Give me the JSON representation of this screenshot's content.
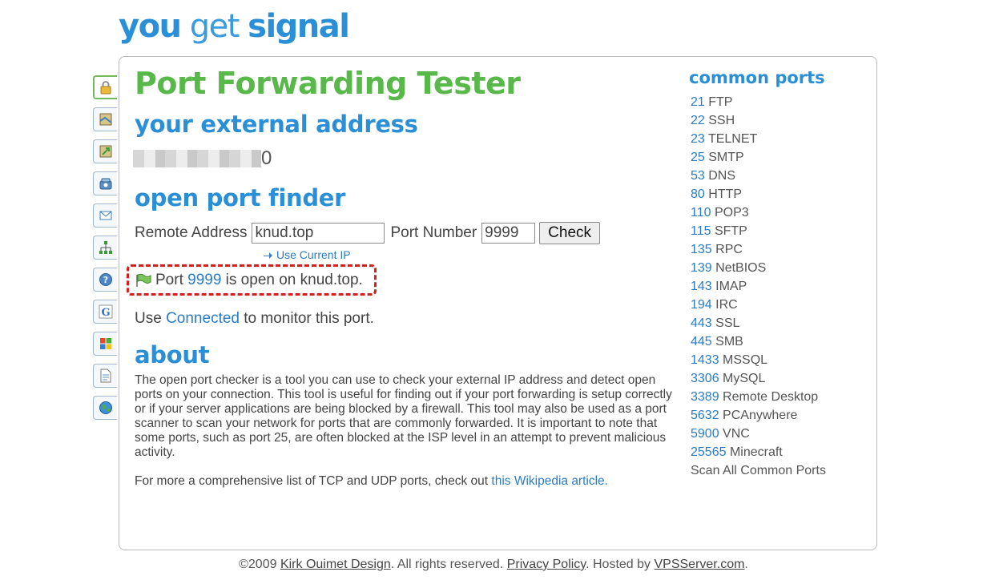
{
  "logo": {
    "part1": "you",
    "part2": "get",
    "part3": "signal"
  },
  "side_tabs": [
    "lock-icon",
    "map-icon",
    "map-arrow-icon",
    "phone-icon",
    "mail-icon",
    "network-icon",
    "help-icon",
    "google-icon",
    "windows-icon",
    "document-icon",
    "globe-icon"
  ],
  "main": {
    "title": "Port Forwarding Tester",
    "external_heading": "your external address",
    "external_ip_visible": "0",
    "finder_heading": "open port finder",
    "remote_address_label": "Remote Address",
    "remote_address_value": "knud.top",
    "port_number_label": "Port Number",
    "port_value": "9999",
    "check_label": "Check",
    "use_current_ip": "Use Current IP",
    "result": {
      "prefix": "Port ",
      "port": "9999",
      "suffix": " is open on knud.top."
    },
    "monitor": {
      "prefix": "Use ",
      "link": "Connected",
      "suffix": " to monitor this port."
    },
    "about_heading": "about",
    "about_text": "The open port checker is a tool you can use to check your external IP address and detect open ports on your connection. This tool is useful for finding out if your port forwarding is setup correctly or if your server applications are being blocked by a firewall. This tool may also be used as a port scanner to scan your network for ports that are commonly forwarded. It is important to note that some ports, such as port 25, are often blocked at the ISP level in an attempt to prevent malicious activity.",
    "about_more_prefix": "For more a comprehensive list of TCP and UDP ports, check out ",
    "about_more_link": "this Wikipedia article."
  },
  "common_ports": {
    "title": "common ports",
    "items": [
      {
        "port": "21",
        "name": " FTP"
      },
      {
        "port": "22",
        "name": " SSH"
      },
      {
        "port": "23",
        "name": " TELNET"
      },
      {
        "port": "25",
        "name": " SMTP"
      },
      {
        "port": "53",
        "name": " DNS"
      },
      {
        "port": "80",
        "name": " HTTP"
      },
      {
        "port": "110",
        "name": " POP3"
      },
      {
        "port": "115",
        "name": " SFTP"
      },
      {
        "port": "135",
        "name": " RPC"
      },
      {
        "port": "139",
        "name": " NetBIOS"
      },
      {
        "port": "143",
        "name": " IMAP"
      },
      {
        "port": "194",
        "name": " IRC"
      },
      {
        "port": "443",
        "name": " SSL"
      },
      {
        "port": "445",
        "name": " SMB"
      },
      {
        "port": "1433",
        "name": " MSSQL"
      },
      {
        "port": "3306",
        "name": " MySQL"
      },
      {
        "port": "3389",
        "name": " Remote Desktop"
      },
      {
        "port": "5632",
        "name": " PCAnywhere"
      },
      {
        "port": "5900",
        "name": " VNC"
      },
      {
        "port": "25565",
        "name": " Minecraft"
      }
    ],
    "scan_all": "Scan All Common Ports"
  },
  "footer": {
    "copyright": "©2009 ",
    "author": "Kirk Ouimet Design",
    "rights": ". All rights reserved. ",
    "privacy": "Privacy Policy",
    "hosted": ". Hosted by ",
    "host": "VPSServer.com",
    "end": "."
  }
}
